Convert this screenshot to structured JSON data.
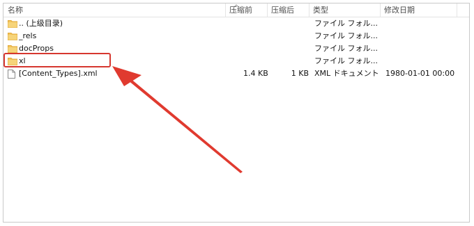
{
  "columns": {
    "name": "名称",
    "size": "压缩前",
    "packed": "压缩后",
    "type": "类型",
    "date": "修改日期"
  },
  "rows": [
    {
      "name": ".. (上级目录)",
      "size": "",
      "packed": "",
      "type": "ファイル フォル...",
      "date": "",
      "icon": "folder-icon"
    },
    {
      "name": "_rels",
      "size": "",
      "packed": "",
      "type": "ファイル フォル...",
      "date": "",
      "icon": "folder-icon"
    },
    {
      "name": "docProps",
      "size": "",
      "packed": "",
      "type": "ファイル フォル...",
      "date": "",
      "icon": "folder-icon"
    },
    {
      "name": "xl",
      "size": "",
      "packed": "",
      "type": "ファイル フォル...",
      "date": "",
      "icon": "folder-icon"
    },
    {
      "name": "[Content_Types].xml",
      "size": "1.4 KB",
      "packed": "1 KB",
      "type": "XML ドキュメント",
      "date": "1980-01-01 00:00",
      "icon": "file-icon"
    }
  ],
  "colors": {
    "highlight": "#d6372f",
    "folder": "#f2c45a",
    "folder_dark": "#e2a93a"
  }
}
